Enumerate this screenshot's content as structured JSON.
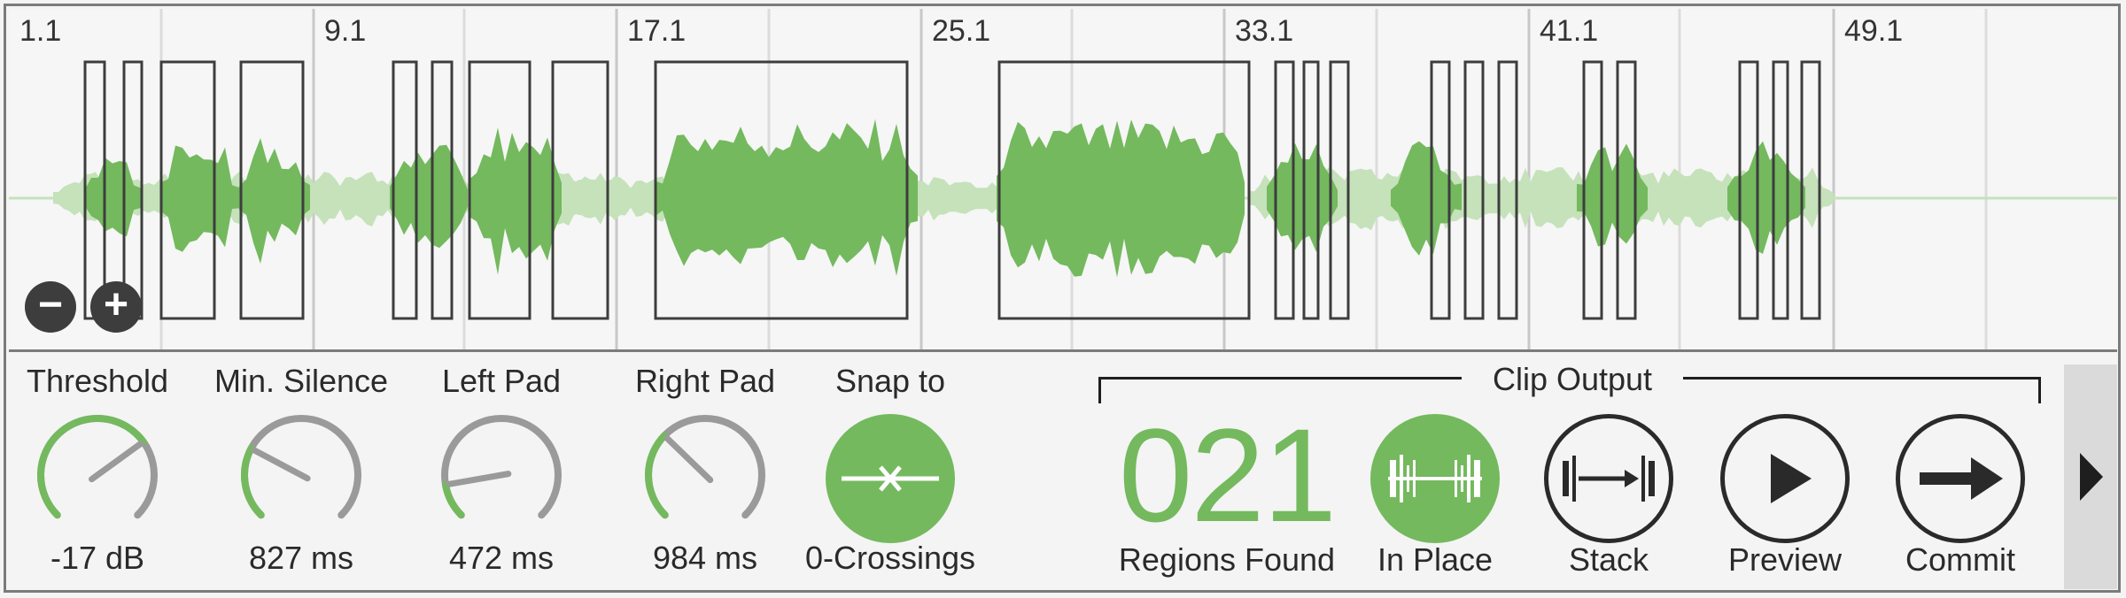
{
  "timeline": {
    "bar_labels": [
      "1.1",
      "9.1",
      "17.1",
      "25.1",
      "33.1",
      "41.1",
      "49.1"
    ]
  },
  "zoom": {
    "minus_icon": "zoom-out-icon",
    "plus_icon": "zoom-in-icon"
  },
  "params": [
    {
      "label": "Threshold",
      "value": "-17 dB",
      "level": 0.7
    },
    {
      "label": "Min. Silence",
      "value": "827 ms",
      "level": 0.27
    },
    {
      "label": "Left Pad",
      "value": "472 ms",
      "level": 0.13
    },
    {
      "label": "Right Pad",
      "value": "984 ms",
      "level": 0.33
    }
  ],
  "snap": {
    "label": "Snap to",
    "value": "0-Crossings",
    "icon": "zero-crossing-icon"
  },
  "clip_output": {
    "title": "Clip Output",
    "regions_count": "021",
    "regions_label": "Regions Found",
    "buttons": [
      {
        "label": "In Place",
        "icon": "in-place-icon"
      },
      {
        "label": "Stack",
        "icon": "stack-icon"
      },
      {
        "label": "Preview",
        "icon": "play-icon"
      },
      {
        "label": "Commit",
        "icon": "arrow-right-icon"
      }
    ]
  },
  "colors": {
    "accent": "#74b95e",
    "accent_light": "#c5e2bb",
    "outline": "#3d3d3d"
  }
}
